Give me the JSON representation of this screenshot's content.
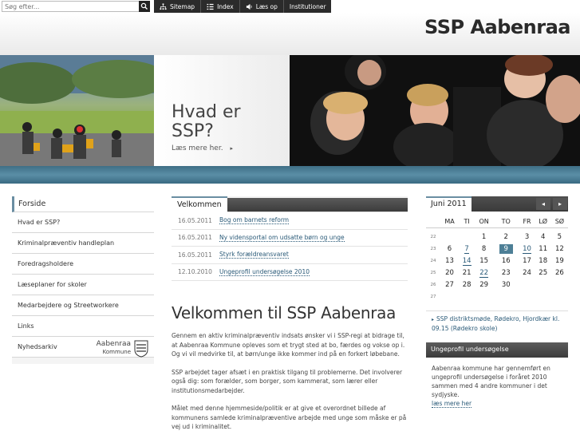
{
  "topbar": {
    "search_placeholder": "Søg efter...",
    "nav": [
      {
        "label": "Sitemap",
        "icon": "sitemap-icon"
      },
      {
        "label": "Index",
        "icon": "index-icon"
      },
      {
        "label": "Læs op",
        "icon": "speaker-icon"
      },
      {
        "label": "Institutioner",
        "icon": ""
      }
    ]
  },
  "header": {
    "logo": "SSP Aabenraa"
  },
  "banner": {
    "title_line1": "Hvad er",
    "title_line2": "SSP?",
    "link": "Læs mere her."
  },
  "sidebar": {
    "items": [
      "Forside",
      "Hvad er SSP?",
      "Kriminalpræventiv handleplan",
      "Foredragsholdere",
      "Læseplaner for skoler",
      "Medarbejdere og Streetworkere",
      "Links",
      "Nyhedsarkiv"
    ],
    "brand_line1": "Aabenraa",
    "brand_line2": "Kommune"
  },
  "news": {
    "tab": "Velkommen",
    "items": [
      {
        "date": "16.05.2011",
        "title": "Bog om barnets reform"
      },
      {
        "date": "16.05.2011",
        "title": "Ny vidensportal om udsatte børn og unge"
      },
      {
        "date": "16.05.2011",
        "title": "Styrk forældreansvaret"
      },
      {
        "date": "12.10.2010",
        "title": "Ungeprofil undersøgelse 2010"
      }
    ]
  },
  "main": {
    "title": "Velkommen til SSP Aabenraa",
    "paragraphs": [
      "Gennem en aktiv kriminalpræventiv indsats ønsker vi i SSP-regi at bidrage til, at Aabenraa Kommune opleves som et trygt sted at bo, færdes og vokse op i. Og vi vil medvirke til, at børn/unge ikke kommer ind på en forkert løbebane.",
      "SSP arbejdet tager afsæt i en praktisk tilgang til problemerne. Det involverer også dig: som forælder, som borger, som kammerat, som lærer eller institutionsmedarbejder.",
      "Målet med denne hjemmeside/politik er at give et overordnet billede af kommunens samlede kriminalpræventive arbejde med unge som måske er på vej ud i kriminalitet."
    ]
  },
  "calendar": {
    "month": "Juni 2011",
    "prev": "◂",
    "next": "▸",
    "weekdays": [
      "MA",
      "TI",
      "ON",
      "TO",
      "FR",
      "LØ",
      "SØ"
    ],
    "weeks": [
      {
        "wk": "22",
        "days": [
          "",
          "",
          "1",
          "2",
          "3",
          "4",
          "5"
        ]
      },
      {
        "wk": "23",
        "days": [
          "6",
          "7",
          "8",
          "9",
          "10",
          "11",
          "12"
        ]
      },
      {
        "wk": "24",
        "days": [
          "13",
          "14",
          "15",
          "16",
          "17",
          "18",
          "19"
        ]
      },
      {
        "wk": "25",
        "days": [
          "20",
          "21",
          "22",
          "23",
          "24",
          "25",
          "26"
        ]
      },
      {
        "wk": "26",
        "days": [
          "27",
          "28",
          "29",
          "30",
          "",
          "",
          ""
        ]
      },
      {
        "wk": "27",
        "days": [
          "",
          "",
          "",
          "",
          "",
          "",
          ""
        ]
      }
    ],
    "event": "SSP distriktsmøde, Rødekro, Hjordkær kl. 09.15 (Rødekro skole)"
  },
  "survey": {
    "title": "Ungeprofil undersøgelse",
    "text": "Aabenraa kommune har gennemført en ungeprofil undersøgelse i foråret 2010 sammen med 4 andre kommuner i det sydjyske.",
    "link": "læs mere her"
  },
  "colors": {
    "accent": "#4d7f96",
    "link": "#2a5a78",
    "dark_bar": "#3c3c3c"
  }
}
